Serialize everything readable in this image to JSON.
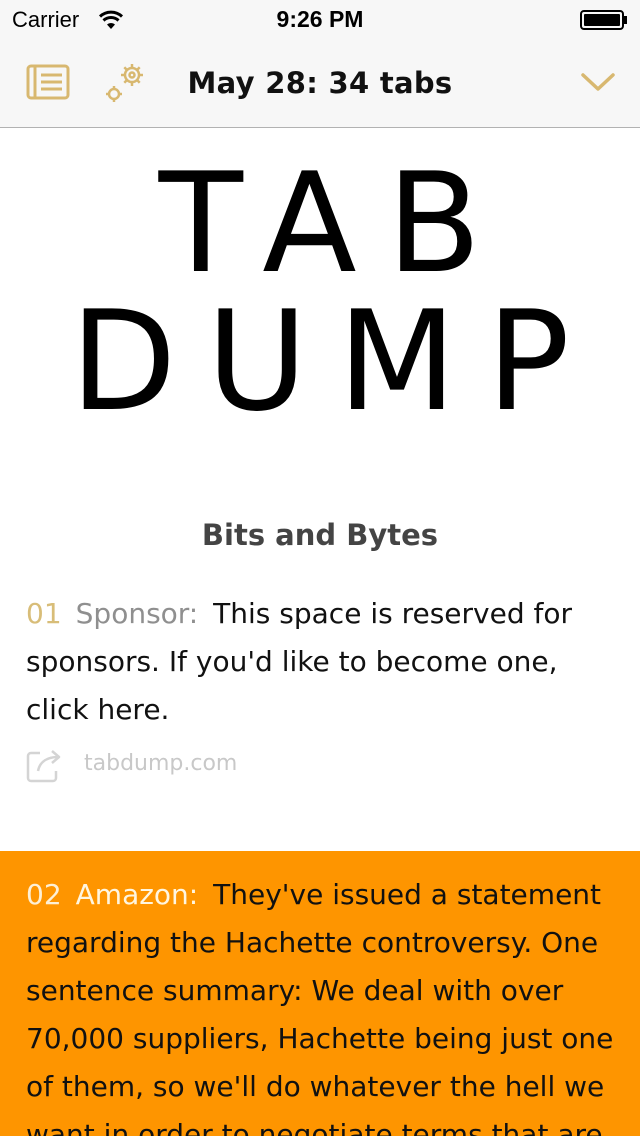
{
  "status_bar": {
    "carrier": "Carrier",
    "time": "9:26 PM"
  },
  "nav": {
    "title": "May 28: 34 tabs",
    "accent_color": "#d8b870",
    "left_icons": [
      "list-icon",
      "gear-icon"
    ],
    "right_icon": "chevron-down-icon"
  },
  "logo": {
    "line1": "TAB",
    "line2": "DUMP"
  },
  "section": {
    "title": "Bits and Bytes"
  },
  "items": [
    {
      "number": "01",
      "label": "Sponsor:",
      "text": "This space is reserved for sponsors. If you'd like to become one, click here.",
      "link": "tabdump.com",
      "link_icon": "share-icon",
      "background": "#ffffff"
    },
    {
      "number": "02",
      "label": "Amazon:",
      "text": "They've issued a statement regarding the Hachette controversy. One sentence summary: We deal with over 70,000 suppliers, Hachette being just one of them, so we'll do whatever the hell we want in order to negotiate terms that are",
      "background": "#fe9500"
    }
  ]
}
